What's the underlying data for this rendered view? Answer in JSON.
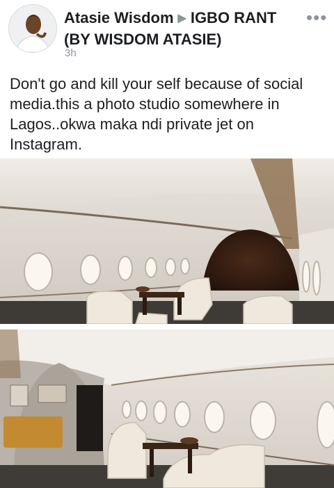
{
  "post": {
    "author": "Atasie Wisdom",
    "group": "IGBO RANT",
    "group_suffix": "(BY WISDOM ATASIE)",
    "time": "3h",
    "text": "Don't go and kill your self because of social media.this a photo studio somewhere in Lagos..okwa maka ndi private jet on Instagram."
  },
  "icons": {
    "arrow": "triangle-right-icon",
    "more": "more-dots-icon",
    "avatar": "profile-avatar"
  },
  "photos": [
    {
      "name": "jet-interior-photo-1"
    },
    {
      "name": "jet-interior-photo-2"
    }
  ]
}
